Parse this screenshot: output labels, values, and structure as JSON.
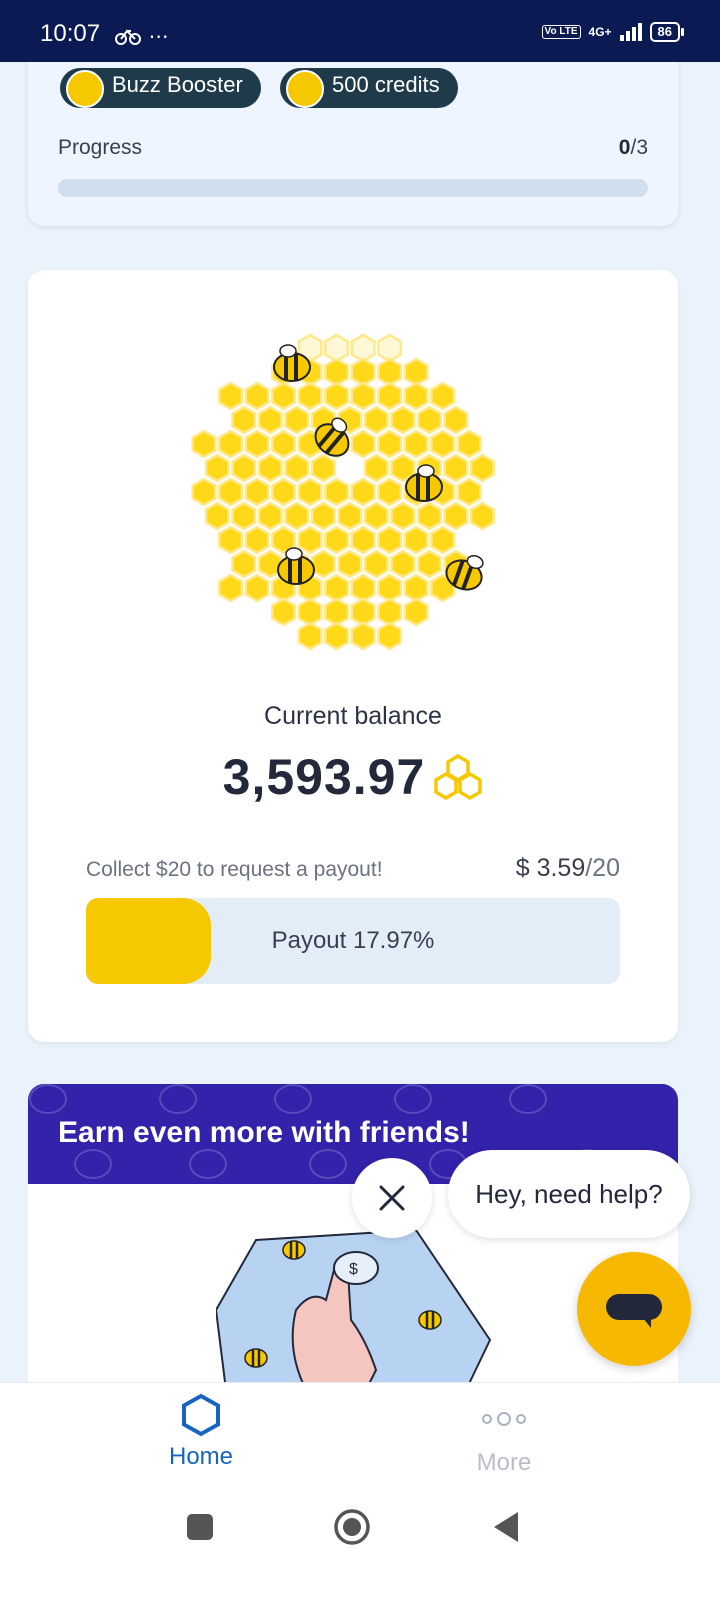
{
  "status_bar": {
    "time": "10:07",
    "left_icons": "⋯",
    "volte": "Vo LTE",
    "network": "4G+",
    "battery": "86"
  },
  "challenge_card": {
    "chips": [
      {
        "label": "Buzz Booster",
        "icon": "bee-icon"
      },
      {
        "label": "500 credits",
        "icon": "coin-icon"
      }
    ],
    "progress_label": "Progress",
    "progress_done": "0",
    "progress_total": "/3",
    "progress_fraction": 0
  },
  "balance_card": {
    "label": "Current balance",
    "value": "3,593.97",
    "currency_icon": "honeycomb-icon",
    "payout_hint": "Collect $20 to request a payout!",
    "payout_current": "$ 3.59",
    "payout_target": "/20",
    "payout_label": "Payout 17.97%",
    "payout_fraction": 0.1797
  },
  "friends_card": {
    "title": "Earn even more with friends!"
  },
  "chat": {
    "bubble_text": "Hey, need help?"
  },
  "tabs": [
    {
      "label": "Home",
      "icon": "hexagon-icon",
      "active": true
    },
    {
      "label": "More",
      "icon": "more-dots-icon",
      "active": false
    }
  ],
  "colors": {
    "accent_yellow": "#f6c800",
    "primary_blue": "#1565c0",
    "status_bar": "#0b1a52",
    "friends_header": "#3322aa"
  }
}
